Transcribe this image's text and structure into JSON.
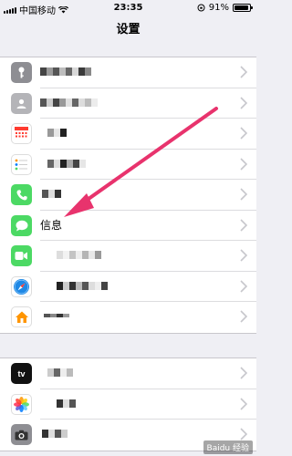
{
  "status_bar": {
    "carrier": "中国移动",
    "time": "23:35",
    "battery_percent": "91%",
    "battery_level": 0.91
  },
  "nav": {
    "title": "设置"
  },
  "rows": [
    {
      "label": "",
      "icon": "key-icon",
      "color": "#8e8e93"
    },
    {
      "label": "",
      "icon": "contacts-icon",
      "color": "#a7a7ab"
    },
    {
      "label": "",
      "icon": "calendar-icon",
      "color": "#ffffff"
    },
    {
      "label": "",
      "icon": "reminders-icon",
      "color": "#ffffff"
    },
    {
      "label": "",
      "icon": "phone-icon",
      "color": "#4cd964"
    },
    {
      "label": "信息",
      "icon": "messages-icon",
      "color": "#4cd964"
    },
    {
      "label": "",
      "icon": "facetime-icon",
      "color": "#4cd964"
    },
    {
      "label": "",
      "icon": "safari-icon",
      "color": "#1e88e5"
    },
    {
      "label": "",
      "icon": "home-icon",
      "color": "#ffffff"
    }
  ],
  "rows2": [
    {
      "label": "",
      "icon": "tv-icon",
      "color": "#111111"
    },
    {
      "label": "",
      "icon": "photos-icon",
      "color": "#ffffff"
    },
    {
      "label": "",
      "icon": "camera-icon",
      "color": "#8e8e93"
    }
  ],
  "tv_icon_text": "tv",
  "watermark": "Baidu 经验",
  "arrow_color": "#e8336d"
}
